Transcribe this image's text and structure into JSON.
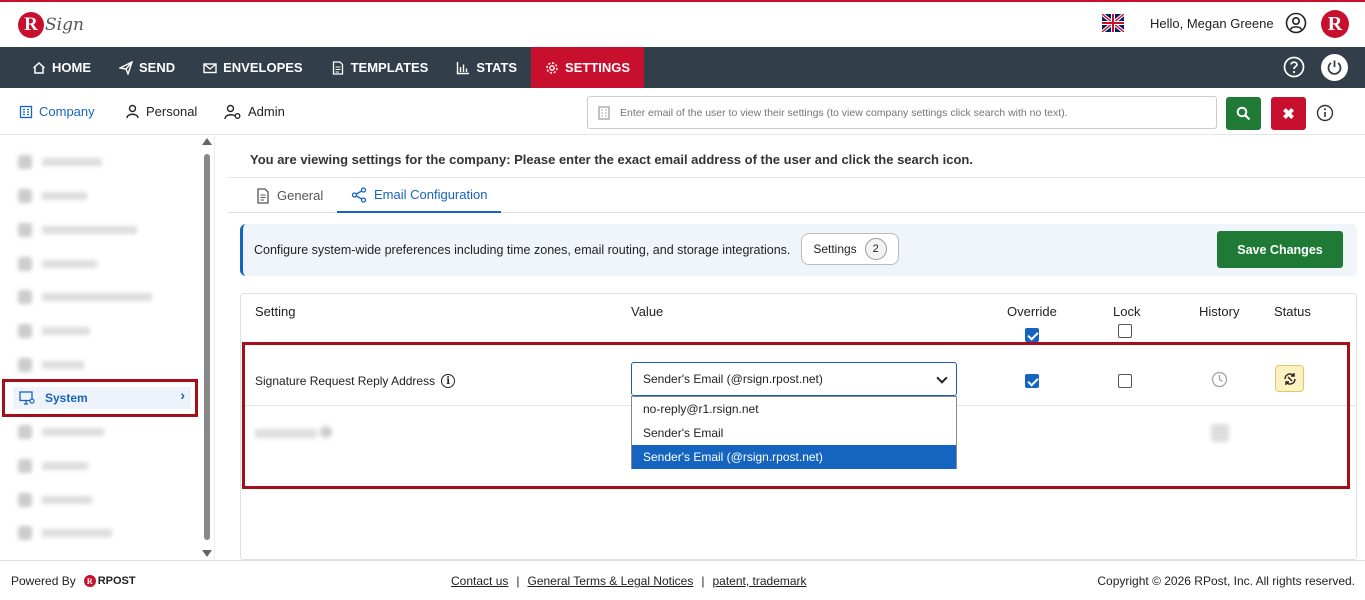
{
  "header": {
    "logo_sign": "Sign",
    "greeting": "Hello, Megan Greene"
  },
  "nav": {
    "items": [
      {
        "label": "HOME",
        "icon": "home-icon"
      },
      {
        "label": "SEND",
        "icon": "send-icon"
      },
      {
        "label": "ENVELOPES",
        "icon": "envelope-icon"
      },
      {
        "label": "TEMPLATES",
        "icon": "template-icon"
      },
      {
        "label": "STATS",
        "icon": "stats-icon"
      },
      {
        "label": "SETTINGS",
        "icon": "gear-icon"
      }
    ],
    "active": "SETTINGS"
  },
  "scope_tabs": [
    {
      "label": "Company",
      "active": true
    },
    {
      "label": "Personal",
      "active": false
    },
    {
      "label": "Admin",
      "active": false
    }
  ],
  "search": {
    "placeholder": "Enter email of the user to view their settings (to view company settings click search with no text)."
  },
  "sidebar": {
    "active_item": "System"
  },
  "main": {
    "viewing_message": "You are viewing settings for the company: Please enter the exact email address of the user and click the search icon.",
    "tabs": [
      {
        "label": "General",
        "active": false
      },
      {
        "label": "Email Configuration",
        "active": true
      }
    ],
    "banner_text": "Configure system-wide preferences including time zones, email routing, and storage integrations.",
    "settings_label": "Settings",
    "settings_count": "2",
    "save_label": "Save Changes"
  },
  "table": {
    "headers": {
      "setting": "Setting",
      "value": "Value",
      "override": "Override",
      "lock": "Lock",
      "history": "History",
      "status": "Status"
    },
    "header_override_checked": true,
    "header_lock_checked": false,
    "row": {
      "label": "Signature Request Reply Address",
      "selected_value": "Sender's Email (@rsign.rpost.net)",
      "override_checked": true,
      "lock_checked": false
    },
    "dropdown_options": [
      "no-reply@r1.rsign.net",
      "Sender's Email",
      "Sender's Email (@rsign.rpost.net)"
    ]
  },
  "footer": {
    "powered_by": "Powered By",
    "rpost": "RPOST",
    "links": [
      "Contact us",
      "General Terms & Legal Notices",
      "patent, trademark"
    ],
    "copyright": "Copyright © 2026 RPost, Inc. All rights reserved."
  },
  "colors": {
    "brand_red": "#c8102e",
    "nav_bg": "#333e4b",
    "primary_blue": "#1565c0",
    "success_green": "#1e7a34",
    "highlight_border": "#a50e1a"
  }
}
